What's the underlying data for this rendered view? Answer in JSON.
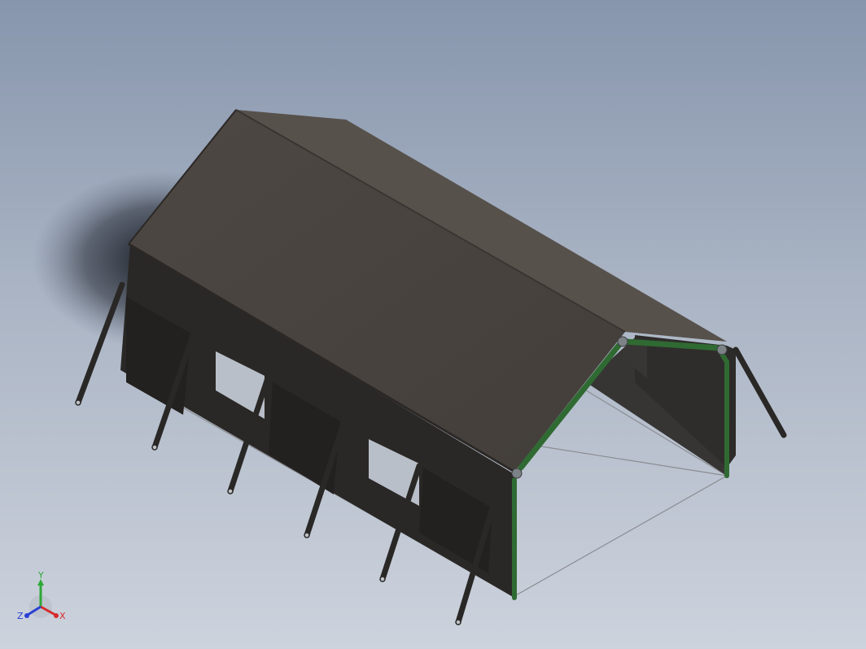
{
  "viewport": {
    "background_top": "#8796ad",
    "background_bottom": "#cdd3dd"
  },
  "model": {
    "roof_color": "#4a4440",
    "roof_highlight": "#56504b",
    "wall_color": "#2b2927",
    "frame_color": "#2f6a32",
    "pole_color": "#2a2826"
  },
  "triad": {
    "x_label": "X",
    "y_label": "Y",
    "z_label": "Z",
    "x_color": "#d42b2b",
    "y_color": "#2ea836",
    "z_color": "#2b3fd4"
  }
}
